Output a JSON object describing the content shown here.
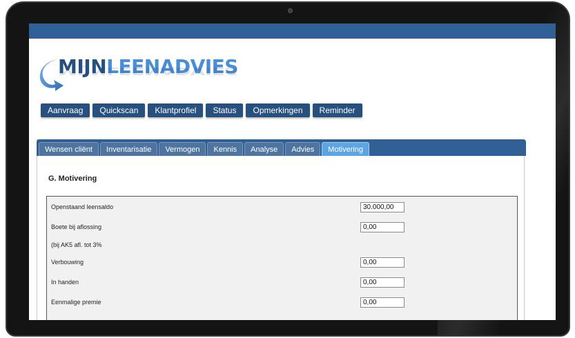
{
  "logo": {
    "part1": "MIJN",
    "part2": "LEENADVIES"
  },
  "nav": [
    "Aanvraag",
    "Quickscan",
    "Klantprofiel",
    "Status",
    "Opmerkingen",
    "Reminder"
  ],
  "tabs": [
    "Wensen cliënt",
    "Inventarisatie",
    "Vermogen",
    "Kennis",
    "Analyse",
    "Advies",
    "Motivering"
  ],
  "active_tab": "Motivering",
  "section_title": "G. Motivering",
  "rows": [
    {
      "label": "Openstaand leensaldo",
      "value": "30.000,00"
    },
    {
      "label": "Boete bij aflossing",
      "value": "0,00"
    },
    {
      "label": "(bij AK5 afl. tot 3%",
      "value": null
    },
    {
      "label": "Verbouwing",
      "value": "0,00"
    },
    {
      "label": "In handen",
      "value": "0,00"
    },
    {
      "label": "Eenmalige premie",
      "value": "0,00"
    }
  ],
  "colors": {
    "brand_dark": "#26507f",
    "brand_light": "#4a8ed6",
    "tab_active": "#5da5e2",
    "topbar": "#2f5f95"
  }
}
